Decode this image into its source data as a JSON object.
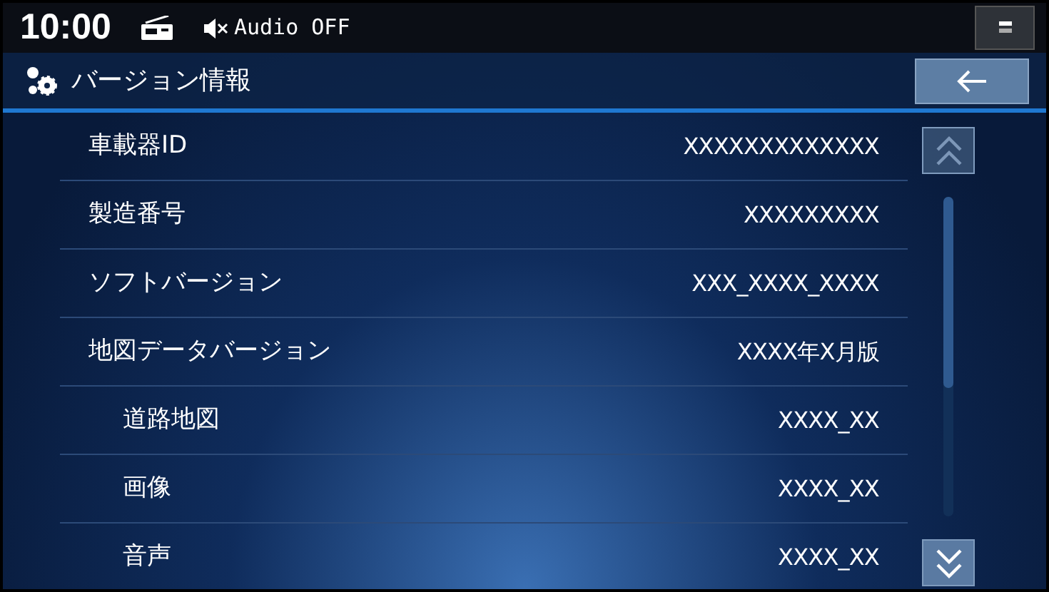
{
  "status_bar": {
    "time": "10:00",
    "audio": "Audio OFF"
  },
  "title_bar": {
    "title": "バージョン情報"
  },
  "rows": [
    {
      "label": "車載器ID",
      "value": "XXXXXXXXXXXXX"
    },
    {
      "label": "製造番号",
      "value": "XXXXXXXXX"
    },
    {
      "label": "ソフトバージョン",
      "value": "XXX_XXXX_XXXX"
    },
    {
      "label": "地図データバージョン",
      "value": "XXXX年X月版",
      "children": [
        {
          "label": "道路地図",
          "value": "XXXX_XX"
        },
        {
          "label": "画像",
          "value": "XXXX_XX"
        },
        {
          "label": "音声",
          "value": "XXXX_XX"
        }
      ]
    }
  ],
  "scroll_up": {
    "disabled": true
  },
  "scroll_down": {
    "disabled": false
  }
}
